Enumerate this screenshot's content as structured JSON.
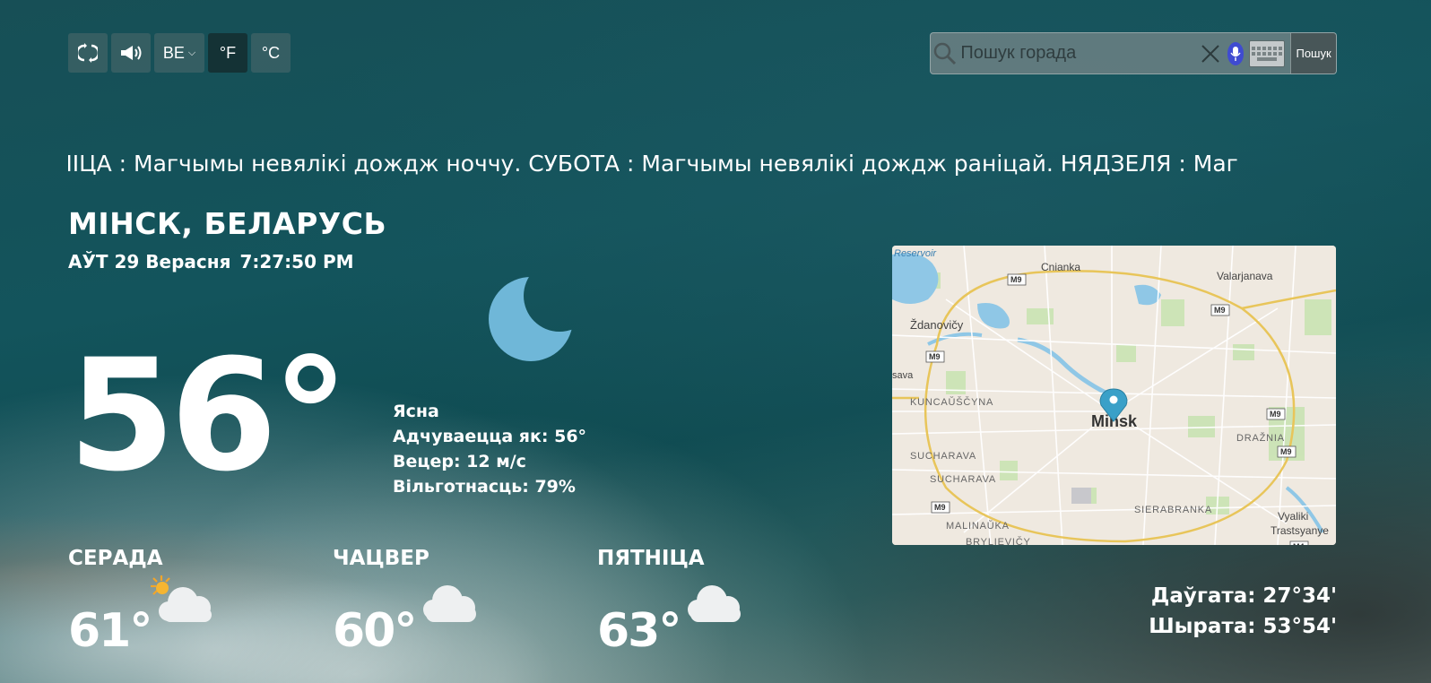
{
  "toolbar": {
    "refresh_icon": "refresh-icon",
    "speak_icon": "speaker-icon",
    "language": "BE",
    "unit_f": "°F",
    "unit_c": "°C",
    "active_unit": "F"
  },
  "search": {
    "placeholder": "Пошук горада",
    "button_label": "Пошук"
  },
  "ticker": "НІЦА : Магчымы невялікі дождж ноччу. СУБОТА : Магчымы невялікі дождж раніцай. НЯДЗЕЛЯ : Маг",
  "location": {
    "city": "МІНСК, БЕЛАРУСЬ",
    "date": "АЎТ 29 Верасня",
    "time": "7:27:50 PM"
  },
  "current": {
    "temp": "56°",
    "icon": "moon-icon",
    "condition": "Ясна",
    "feels_like": "Адчуваецца як: 56°",
    "wind": "Вецер: 12 м/с",
    "humidity": "Вільготнасць: 79%"
  },
  "forecast": [
    {
      "day": "СЕРАДА",
      "temp": "61°",
      "icon": "partly-cloudy-icon"
    },
    {
      "day": "ЧАЦВЕР",
      "temp": "60°",
      "icon": "cloud-icon"
    },
    {
      "day": "ПЯТНІЦА",
      "temp": "63°",
      "icon": "cloud-icon"
    }
  ],
  "map": {
    "labels": {
      "reservoir": "Reservoir",
      "cnianka": "Cnianka",
      "valarjanava": "Valarjanava",
      "zdanovicy": "Ždanovičy",
      "sava": "sava",
      "kuncauscyna": "KUNCAŬŠČYNA",
      "minsk": "Minsk",
      "draznia": "DRAŽNIA",
      "sucharava1": "SUCHARAVA",
      "sucharava2": "SUCHARAVA",
      "sierabranka": "SIERABRANKA",
      "malinauka": "MALINAŬKA",
      "brylievicy": "BRYLIEVIČY",
      "vyaliki": "Vyaliki",
      "trastsyanye": "Trastsyanye",
      "m9": "M9",
      "m4": "M4"
    }
  },
  "coordinates": {
    "longitude": "Даўгата: 27°34'",
    "latitude": "Шырата: 53°54'"
  },
  "colors": {
    "moon": "#6fb7d8",
    "mic": "#3f4bd1",
    "map_pin": "#3aa0c8"
  }
}
